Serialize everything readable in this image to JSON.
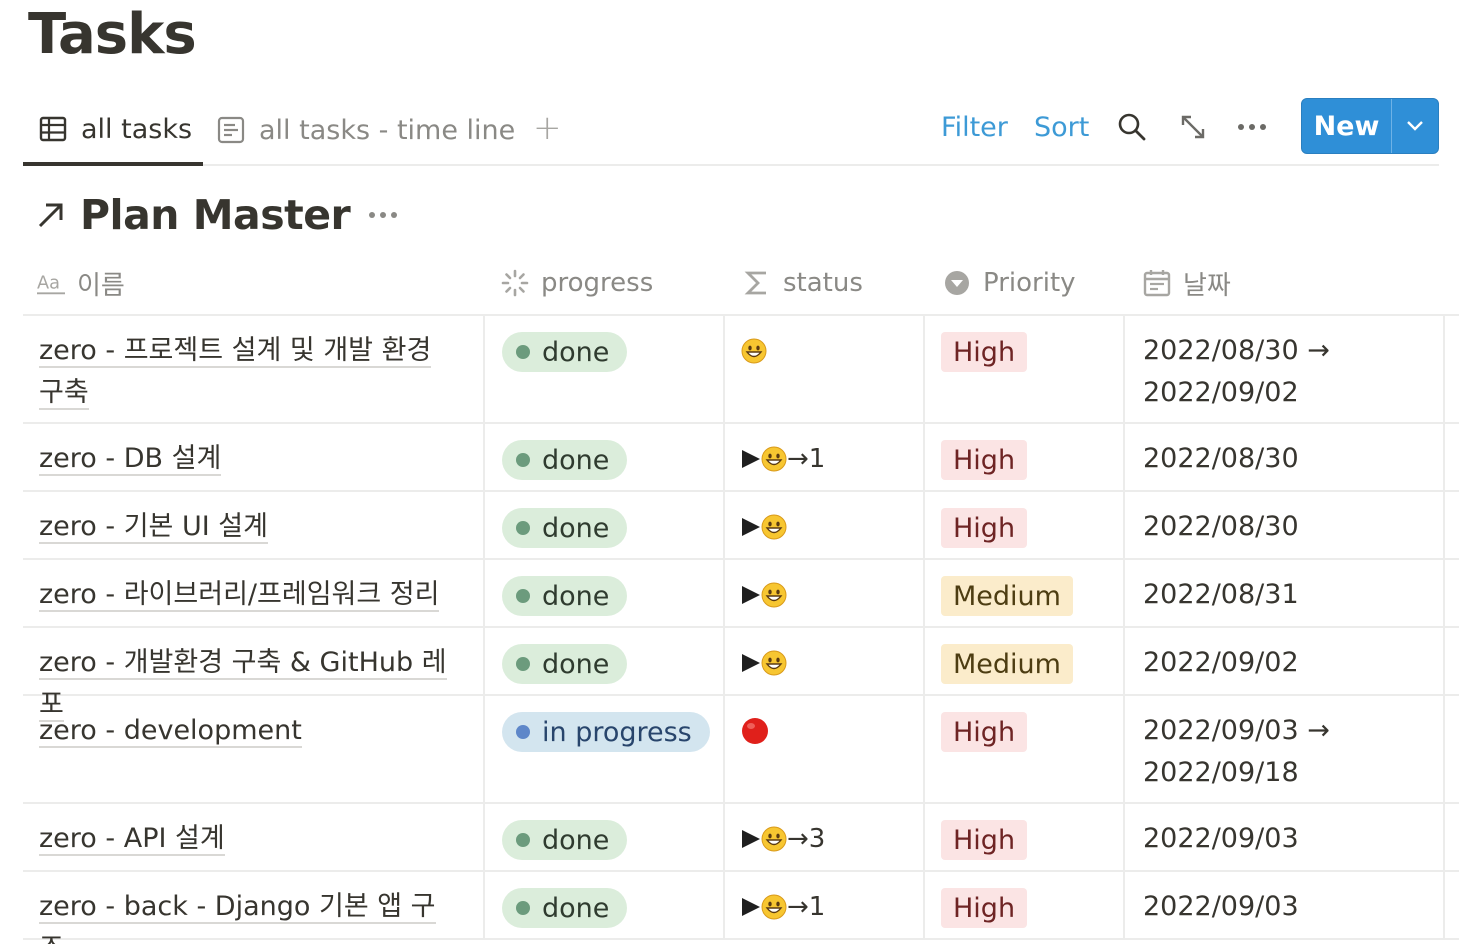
{
  "page": {
    "title": "Tasks"
  },
  "views": {
    "tabs": [
      {
        "label": "all tasks",
        "icon": "table-icon",
        "active": true
      },
      {
        "label": "all tasks - time line",
        "icon": "timeline-icon",
        "active": false
      }
    ],
    "add_label": "+"
  },
  "toolbar": {
    "filter": "Filter",
    "sort": "Sort",
    "new": "New"
  },
  "database": {
    "title": "Plan Master"
  },
  "columns": [
    {
      "label": "이름",
      "icon": "text-property-icon"
    },
    {
      "label": "progress",
      "icon": "status-property-icon"
    },
    {
      "label": "status",
      "icon": "formula-sigma-icon"
    },
    {
      "label": "Priority",
      "icon": "select-property-icon"
    },
    {
      "label": "날짜",
      "icon": "calendar-icon"
    }
  ],
  "rows": [
    {
      "name": "zero - 프로젝트 설계 및 개발 환경 구축",
      "progress": "done",
      "status_text": "",
      "status_icons": [
        "smiley"
      ],
      "priority": "High",
      "date1": "2022/08/30 →",
      "date2": "2022/09/02"
    },
    {
      "name": "zero - DB 설계",
      "progress": "done",
      "status_text": "→1",
      "status_icons": [
        "play",
        "smiley"
      ],
      "priority": "High",
      "date1": "2022/08/30",
      "date2": ""
    },
    {
      "name": "zero - 기본 UI 설계",
      "progress": "done",
      "status_text": "",
      "status_icons": [
        "play",
        "smiley"
      ],
      "priority": "High",
      "date1": "2022/08/30",
      "date2": ""
    },
    {
      "name": "zero - 라이브러리/프레임워크 정리",
      "progress": "done",
      "status_text": "",
      "status_icons": [
        "play",
        "smiley"
      ],
      "priority": "Medium",
      "date1": "2022/08/31",
      "date2": ""
    },
    {
      "name": "zero - 개발환경 구축 & GitHub 레포",
      "progress": "done",
      "status_text": "",
      "status_icons": [
        "play",
        "smiley"
      ],
      "priority": "Medium",
      "date1": "2022/09/02",
      "date2": ""
    },
    {
      "name": "zero - development",
      "progress": "in progress",
      "status_text": "",
      "status_icons": [
        "red-circle"
      ],
      "priority": "High",
      "date1": "2022/09/03 →",
      "date2": "2022/09/18"
    },
    {
      "name": "zero - API 설계",
      "progress": "done",
      "status_text": "→3",
      "status_icons": [
        "play",
        "smiley"
      ],
      "priority": "High",
      "date1": "2022/09/03",
      "date2": ""
    },
    {
      "name": "zero - back - Django 기본 앱 구조",
      "progress": "done",
      "status_text": "→1",
      "status_icons": [
        "play",
        "smiley"
      ],
      "priority": "High",
      "date1": "2022/09/03",
      "date2": ""
    }
  ],
  "colors": {
    "accent_blue": "#2f8fd7",
    "link_blue": "#3d9ad6",
    "done_bg": "#dbeddb",
    "in_progress_bg": "#d3e5ef",
    "high_bg": "#fbe4e4",
    "medium_bg": "#fbeccb"
  }
}
